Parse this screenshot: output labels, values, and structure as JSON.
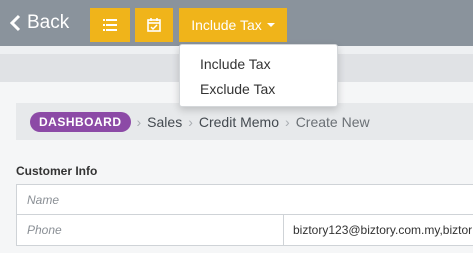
{
  "header": {
    "back_label": "Back",
    "list_icon": "list-icon",
    "calendar_icon": "calendar-check-icon",
    "tax_selected": "Include Tax"
  },
  "tax_dropdown": {
    "options": [
      "Include Tax",
      "Exclude Tax"
    ]
  },
  "breadcrumb": {
    "items": [
      "DASHBOARD",
      "Sales",
      "Credit Memo",
      "Create New"
    ]
  },
  "customer_info": {
    "title": "Customer Info",
    "name_placeholder": "Name",
    "phone_placeholder": "Phone",
    "email_value": "biztory123@biztory.com.my,biztor"
  },
  "colors": {
    "topbar": "#8a939c",
    "accent": "#f0b41a",
    "pill": "#8c4aa6"
  }
}
